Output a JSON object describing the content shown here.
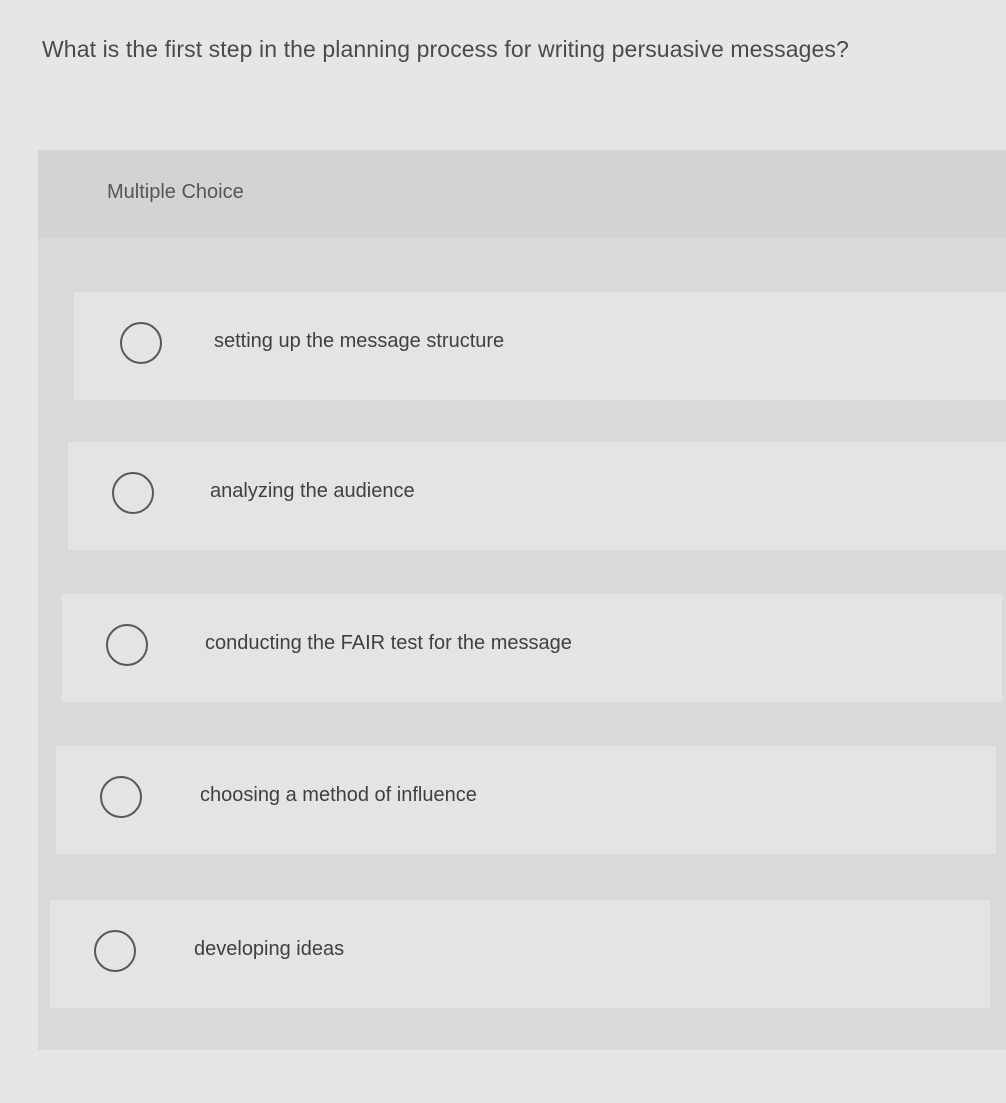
{
  "question": {
    "text": "What is the first step in the planning process for writing persuasive messages?"
  },
  "multiple_choice": {
    "label": "Multiple Choice",
    "options": [
      {
        "text": "setting up the message structure",
        "selected": false
      },
      {
        "text": "analyzing the audience",
        "selected": false
      },
      {
        "text": "conducting the FAIR test for the message",
        "selected": false
      },
      {
        "text": "choosing a method of influence",
        "selected": false
      },
      {
        "text": "developing ideas",
        "selected": false
      }
    ]
  },
  "colors": {
    "background": "#e6e6e7",
    "panel": "#d9d9da",
    "option_card": "#e4e4e5",
    "text": "#3f4044",
    "radio_border": "#57585c"
  }
}
